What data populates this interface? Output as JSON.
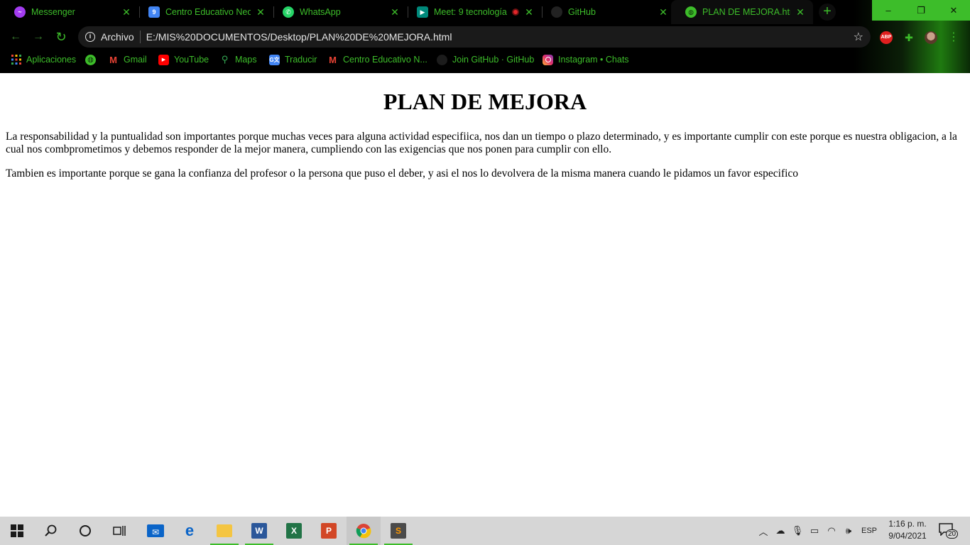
{
  "browser": {
    "tabs": [
      {
        "title": "Messenger",
        "icon": "messenger-icon",
        "color": "#a33cf0"
      },
      {
        "title": "Centro Educativo Neosi",
        "icon": "calendar-icon",
        "color": "#4285f4"
      },
      {
        "title": "WhatsApp",
        "icon": "whatsapp-icon",
        "color": "#25d366"
      },
      {
        "title": "Meet: 9 tecnología",
        "icon": "meet-icon",
        "color": "#00897b"
      },
      {
        "title": "GitHub",
        "icon": "github-icon",
        "color": "#222222"
      },
      {
        "title": "PLAN DE MEJORA.html",
        "icon": "globe-icon",
        "color": "#3dbd2a"
      }
    ],
    "new_tab_label": "+",
    "window_controls": {
      "minimize": "–",
      "restore": "❐",
      "close": "✕"
    },
    "address": {
      "chip_label": "Archivo",
      "url": "E:/MIS%20DOCUMENTOS/Desktop/PLAN%20DE%20MEJORA.html"
    },
    "extensions": {
      "abp_label": "ABP"
    },
    "bookmarks": [
      {
        "label": "Aplicaciones",
        "icon": "apps-grid-icon"
      },
      {
        "label": "",
        "icon": "globe-icon"
      },
      {
        "label": "Gmail",
        "icon": "gmail-icon"
      },
      {
        "label": "YouTube",
        "icon": "youtube-icon"
      },
      {
        "label": "Maps",
        "icon": "maps-pin-icon"
      },
      {
        "label": "Traducir",
        "icon": "translate-icon"
      },
      {
        "label": "Centro Educativo N...",
        "icon": "gmail-icon"
      },
      {
        "label": "Join GitHub · GitHub",
        "icon": "github-icon"
      },
      {
        "label": "Instagram • Chats",
        "icon": "instagram-icon"
      }
    ],
    "accent_color": "#3dbd2a"
  },
  "page": {
    "heading": "PLAN DE MEJORA",
    "paragraphs": [
      "La responsabilidad y la puntualidad son importantes porque muchas veces para alguna actividad especifiica, nos dan un tiempo o plazo determinado, y es importante cumplir con este porque es nuestra obligacion, a la cual nos combprometimos y debemos responder de la mejor manera, cumpliendo con las exigencias que nos ponen para cumplir con ello.",
      "Tambien es importante porque se gana la confianza del profesor o la persona que puso el deber, y asi el nos lo devolvera de la misma manera cuando le pidamos un favor especifico"
    ]
  },
  "taskbar": {
    "apps": [
      {
        "icon": "windows-start-icon"
      },
      {
        "icon": "search-icon"
      },
      {
        "icon": "cortana-icon"
      },
      {
        "icon": "task-view-icon"
      },
      {
        "icon": "mail-icon"
      },
      {
        "icon": "edge-icon"
      },
      {
        "icon": "file-explorer-icon"
      },
      {
        "icon": "word-icon",
        "letter": "W"
      },
      {
        "icon": "excel-icon",
        "letter": "X"
      },
      {
        "icon": "powerpoint-icon",
        "letter": "P"
      },
      {
        "icon": "chrome-icon"
      },
      {
        "icon": "sublime-text-icon",
        "letter": "S"
      }
    ],
    "tray": {
      "language": "ESP",
      "time": "1:16 p. m.",
      "date": "9/04/2021",
      "notification_count": "20"
    }
  }
}
